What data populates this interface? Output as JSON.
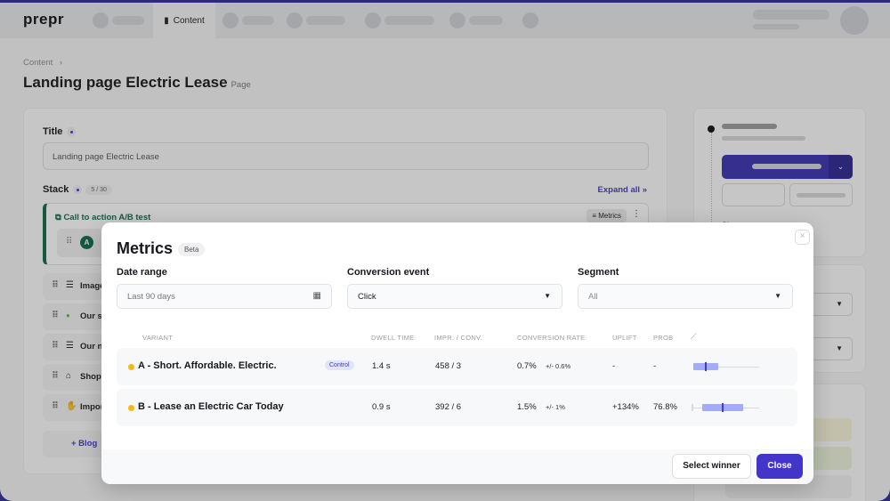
{
  "app": {
    "logo": "prepr",
    "active_nav": "Content"
  },
  "breadcrumb": {
    "items": [
      "Content"
    ],
    "separator": "›"
  },
  "page": {
    "title": "Landing page Electric Lease",
    "type": "Page"
  },
  "editor": {
    "title_field": {
      "label": "Title",
      "value": "Landing page Electric Lease"
    },
    "stack": {
      "label": "Stack",
      "count": "5 / 30",
      "expand_all_label": "Expand all",
      "ab_test": {
        "title": "Call to action A/B test",
        "metrics_button": "Metrics",
        "variant_badge": "A"
      },
      "items": [
        {
          "icon": "list-icon",
          "glyph": "☰",
          "label": "Image"
        },
        {
          "icon": "status-dot-icon",
          "glyph": "●",
          "label": "Our se"
        },
        {
          "icon": "list-icon",
          "glyph": "☰",
          "label": "Our ne"
        },
        {
          "icon": "basket-icon",
          "glyph": "🧺",
          "label": "Shop"
        },
        {
          "icon": "hand-icon",
          "glyph": "✋",
          "label": "Impor"
        }
      ],
      "add_label": "+ Blog"
    }
  },
  "sidebar": {
    "partial_text": "Sha"
  },
  "modal": {
    "title": "Metrics",
    "badge": "Beta",
    "filters": {
      "date_range": {
        "label": "Date range",
        "value": "Last 90 days"
      },
      "conversion_event": {
        "label": "Conversion event",
        "value": "Click"
      },
      "segment": {
        "label": "Segment",
        "value": "All"
      }
    },
    "table": {
      "headers": [
        "VARIANT",
        "DWELL TIME",
        "IMPR. / CONV.",
        "CONVERSION RATE",
        "UPLIFT",
        "PROB"
      ],
      "rows": [
        {
          "variant": "A - Short. Affordable. Electric.",
          "badge": "Control",
          "dwell_time": "1.4 s",
          "impr_conv": "458 / 3",
          "conversion_rate": "0.7%",
          "margin": "+/- 0.6%",
          "uplift": "-",
          "prob": "-",
          "distribution": {
            "low": 0.1,
            "q1": 0.1,
            "median": 0.7,
            "q3": 1.3,
            "high": 3.3
          }
        },
        {
          "variant": "B - Lease an Electric Car Today",
          "badge": "",
          "dwell_time": "0.9 s",
          "impr_conv": "392 / 6",
          "conversion_rate": "1.5%",
          "margin": "+/- 1%",
          "uplift": "+134%",
          "prob": "76.8%",
          "distribution": {
            "low": 0.0,
            "q1": 0.5,
            "median": 1.5,
            "q3": 2.5,
            "high": 3.3
          }
        }
      ]
    },
    "buttons": {
      "select_winner": "Select winner",
      "close": "Close"
    }
  },
  "colors": {
    "primary": "#4335c9",
    "success": "#0f6b45",
    "variant_dot": "#f5b81c",
    "box_fill": "#a4acf7"
  }
}
